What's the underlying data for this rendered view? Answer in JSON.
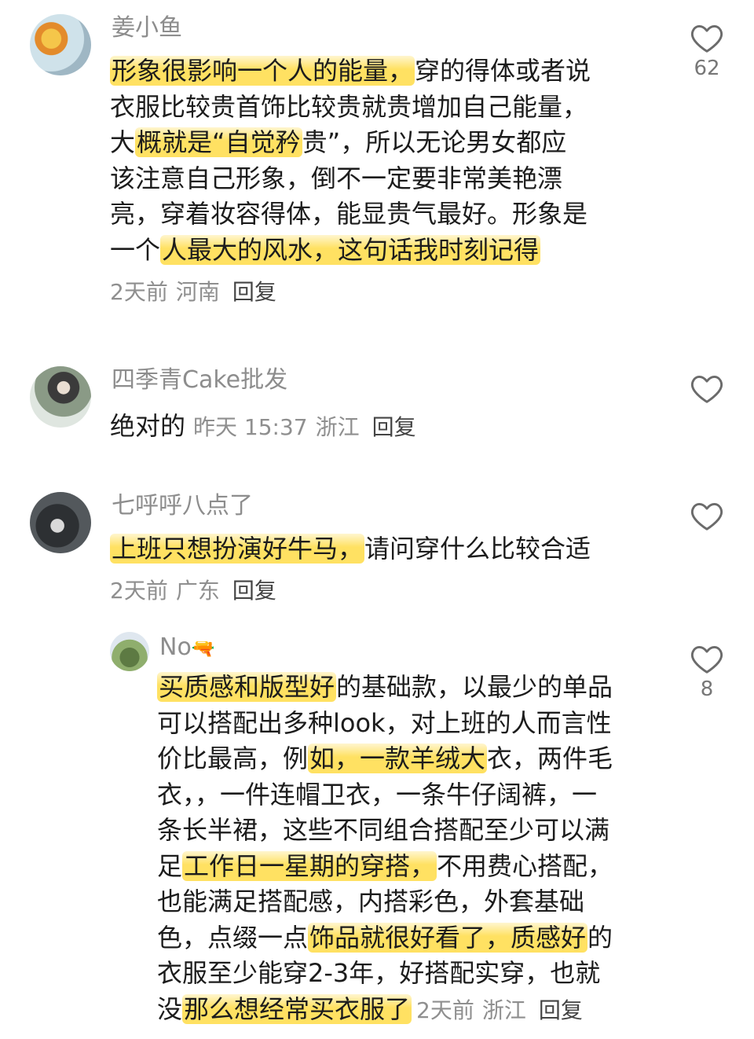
{
  "comments": [
    {
      "username": "姜小鱼",
      "lines": [
        [
          {
            "t": "形象很影响一个人的能量，",
            "h": true
          },
          {
            "t": "穿的得体或者说",
            "h": false
          }
        ],
        [
          {
            "t": "衣服比较贵首饰比较贵就贵增加自己能量，",
            "h": false
          }
        ],
        [
          {
            "t": "大",
            "h": false
          },
          {
            "t": "概就是“自觉矜",
            "h": true
          },
          {
            "t": "贵”，所以无论男女都应",
            "h": false
          }
        ],
        [
          {
            "t": "该注意自己形象，倒不一定要非常美艳漂",
            "h": false
          }
        ],
        [
          {
            "t": "亮，穿着妆容得体，能显贵气最好。形象是",
            "h": false
          }
        ],
        [
          {
            "t": "一个",
            "h": false
          },
          {
            "t": "人最大的风水，这句话我时刻记得",
            "h": true
          }
        ]
      ],
      "time": "2天前",
      "location": "河南",
      "reply": "回复",
      "likes": "62"
    },
    {
      "username": "四季青Cake批发",
      "text": "绝对的",
      "time": "昨天 15:37",
      "location": "浙江",
      "reply": "回复",
      "likes": ""
    },
    {
      "username": "七呼呼八点了",
      "lines": [
        [
          {
            "t": "上班只想扮演好牛马，",
            "h": true
          },
          {
            "t": "请问穿什么比较合适",
            "h": false
          }
        ]
      ],
      "time": "2天前",
      "location": "广东",
      "reply": "回复",
      "likes": ""
    },
    {
      "username": "No",
      "username_emoji": "🔫",
      "lines": [
        [
          {
            "t": "买质感和版型好",
            "h": true
          },
          {
            "t": "的基础款，以最少的单品",
            "h": false
          }
        ],
        [
          {
            "t": "可以搭配出多种look，对上班的人而言性",
            "h": false
          }
        ],
        [
          {
            "t": "价比最高，例",
            "h": false
          },
          {
            "t": "如，一款羊绒大",
            "h": true
          },
          {
            "t": "衣，两件毛",
            "h": false
          }
        ],
        [
          {
            "t": "衣，，一件连帽卫衣，一条牛仔阔裤，一",
            "h": false
          }
        ],
        [
          {
            "t": "条长半裙，这些不同组合搭配至少可以满",
            "h": false
          }
        ],
        [
          {
            "t": "足",
            "h": false
          },
          {
            "t": "工作日一星期的穿搭，",
            "h": true
          },
          {
            "t": "不用费心搭配，",
            "h": false
          }
        ],
        [
          {
            "t": "也能满足搭配感，内搭彩色，外套基础",
            "h": false
          }
        ],
        [
          {
            "t": "色，点缀一点",
            "h": false
          },
          {
            "t": "饰品就很好看了，质感好",
            "h": true
          },
          {
            "t": "的",
            "h": false
          }
        ],
        [
          {
            "t": "衣服至少能穿2-3年，好搭配实穿，也就",
            "h": false
          }
        ],
        [
          {
            "t": "没",
            "h": false
          },
          {
            "t": "那么想经常买衣服了",
            "h": true
          }
        ]
      ],
      "time": "2天前",
      "location": "浙江",
      "reply": "回复",
      "likes": "8"
    }
  ],
  "icons": {
    "like": "heart-outline-icon"
  }
}
